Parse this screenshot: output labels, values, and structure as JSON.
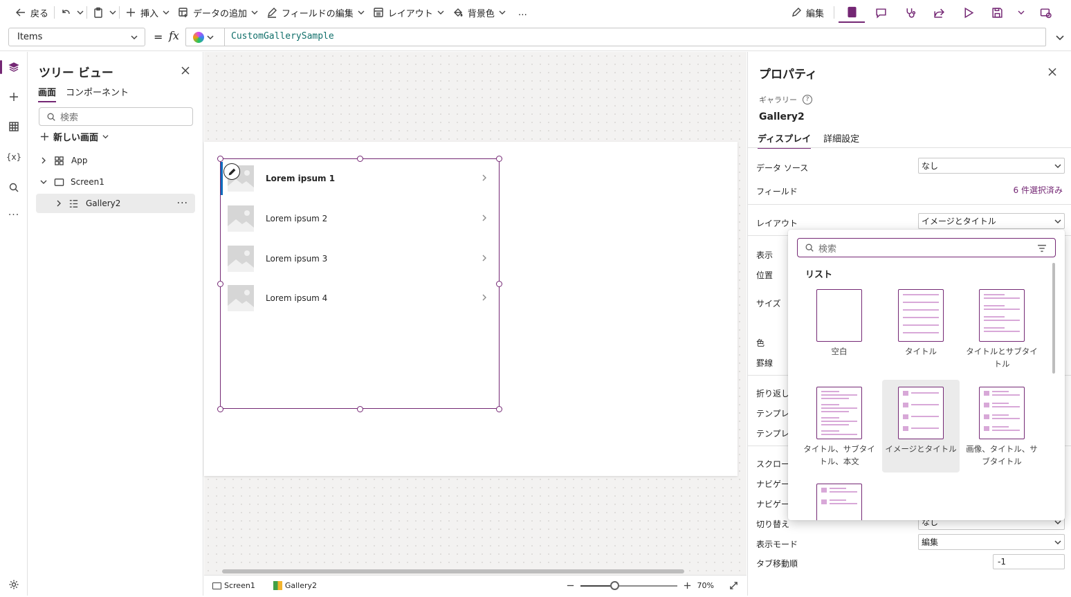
{
  "toolbar": {
    "back_label": "戻る",
    "insert_label": "挿入",
    "add_data_label": "データの追加",
    "edit_fields_label": "フィールドの編集",
    "layout_label": "レイアウト",
    "background_label": "背景色",
    "more_label": "…",
    "edit_label": "編集"
  },
  "formula_bar": {
    "property": "Items",
    "equals": "=",
    "fx": "fx",
    "formula": "CustomGallerySample"
  },
  "tree_view": {
    "title": "ツリー ビュー",
    "tabs": [
      "画面",
      "コンポーネント"
    ],
    "search_placeholder": "検索",
    "new_screen_label": "新しい画面",
    "nodes": [
      {
        "label": "App"
      },
      {
        "label": "Screen1"
      },
      {
        "label": "Gallery2"
      }
    ],
    "more_label": "···"
  },
  "gallery": {
    "items": [
      "Lorem ipsum 1",
      "Lorem ipsum 2",
      "Lorem ipsum 3",
      "Lorem ipsum 4"
    ]
  },
  "status_bar": {
    "screen_tab": "Screen1",
    "gallery_tab": "Gallery2",
    "zoom_level": "70%",
    "zoom_fraction": 0.35
  },
  "properties": {
    "title": "プロパティ",
    "control_type": "ギャラリー",
    "help": "?",
    "control_name": "Gallery2",
    "tabs": [
      "ディスプレイ",
      "詳細設定"
    ],
    "rows": {
      "data_source": {
        "label": "データ ソース",
        "value": "なし"
      },
      "fields": {
        "label": "フィールド",
        "value": "6 件選択済み"
      },
      "layout": {
        "label": "レイアウト",
        "value": "イメージとタイトル"
      },
      "visible": {
        "label": "表示"
      },
      "position": {
        "label": "位置"
      },
      "size": {
        "label": "サイズ"
      },
      "color": {
        "label": "色"
      },
      "border": {
        "label": "罫線"
      },
      "wrap": {
        "label": "折り返しの"
      },
      "template1": {
        "label": "テンプレー"
      },
      "template2": {
        "label": "テンプレー"
      },
      "scroll": {
        "label": "スクロール"
      },
      "nav1": {
        "label": "ナビゲーシ"
      },
      "nav2": {
        "label": "ナビゲーシ"
      },
      "toggle": {
        "label": "切り替え",
        "value": "なし"
      },
      "display_mode": {
        "label": "表示モード",
        "value": "編集"
      },
      "tab_index": {
        "label": "タブ移動順",
        "value": "-1"
      }
    }
  },
  "layout_flyout": {
    "search_placeholder": "検索",
    "section": "リスト",
    "options": [
      {
        "label": "空白"
      },
      {
        "label": "タイトル"
      },
      {
        "label": "タイトルとサブタイトル"
      },
      {
        "label": "タイトル、サブタイトル、本文"
      },
      {
        "label": "イメージとタイトル"
      },
      {
        "label": "画像、タイトル、サブタイトル"
      }
    ]
  },
  "colors": {
    "accent": "#742774",
    "selection_blue": "#0f6cbd",
    "formula_text": "#106f6a"
  }
}
